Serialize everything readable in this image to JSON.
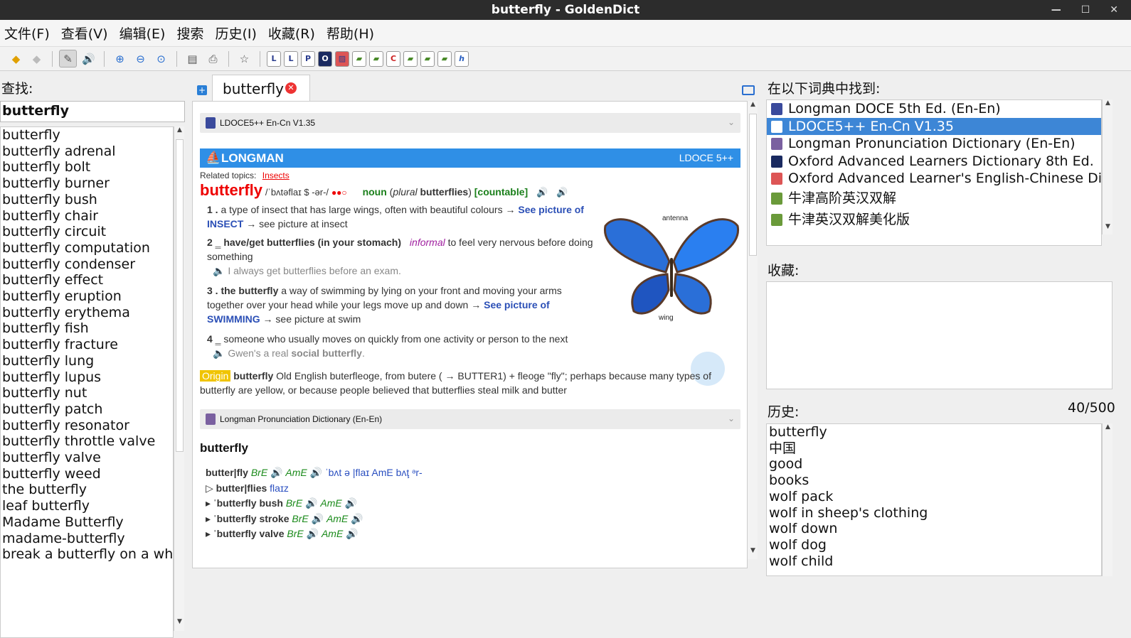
{
  "window": {
    "title": "butterfly - GoldenDict"
  },
  "menu": [
    "文件(F)",
    "查看(V)",
    "编辑(E)",
    "搜索",
    "历史(I)",
    "收藏(R)",
    "帮助(H)"
  ],
  "toolbar_icons": [
    "back-icon",
    "forward-icon",
    "scan-popup-icon",
    "pronounce-icon",
    "zoom-in-icon",
    "zoom-out-icon",
    "zoom-reset-icon",
    "save-icon",
    "print-icon",
    "favorite-icon"
  ],
  "left": {
    "label": "查找:",
    "search_value": "butterfly",
    "words": [
      "butterfly",
      "butterfly adrenal",
      "butterfly bolt",
      "butterfly burner",
      "butterfly bush",
      "butterfly chair",
      "butterfly circuit",
      "butterfly computation",
      "butterfly condenser",
      "butterfly effect",
      "butterfly eruption",
      "butterfly erythema",
      "butterfly fish",
      "butterfly fracture",
      "butterfly lung",
      "butterfly lupus",
      "butterfly nut",
      "butterfly patch",
      "butterfly resonator",
      "butterfly throttle valve",
      "butterfly valve",
      "butterfly weed",
      "the butterfly",
      "leaf butterfly",
      "Madame Butterfly",
      "madame-butterfly",
      "break a butterfly on a wheel"
    ]
  },
  "tab": {
    "label": "butterfly",
    "close": "✕"
  },
  "article": {
    "dict1_title": "LDOCE5++ En-Cn V1.35",
    "brand": "LONGMAN",
    "brand_right": "LDOCE 5++",
    "related_label": "Related topics:",
    "related_link": "Insects",
    "headword": "butterfly",
    "pron": "/ˈbʌtəflaɪ $ -ər-/",
    "freq": "●●○",
    "pos": "noun",
    "plural_label": "plural",
    "plural": "butterflies",
    "countable": "[countable]",
    "s1_num": "1 .",
    "s1_text": "a type of insect that has large wings, often with beautiful colours →",
    "s1_link": "See picture of INSECT",
    "s1_after": "→ see picture at insect",
    "s2_num": "2 ‗",
    "s2_phrase": "have/get butterflies (in your stomach)",
    "s2_reg": "informal",
    "s2_text": "to feel very nervous before doing something",
    "s2_ex": "I always get butterflies before an exam.",
    "s3_num": "3 .",
    "s3_phrase": "the butterfly",
    "s3_text": "a way of swimming by lying on your front and moving your arms together over your head while your legs move up and down →",
    "s3_link": "See picture of SWIMMING",
    "s3_after": "→ see picture at swim",
    "s4_num": "4 ‗",
    "s4_text": "someone who usually moves on quickly from one activity or person to the next",
    "s4_ex_pre": "Gwen's a real",
    "s4_ex_bold": "social butterfly",
    "origin_label": "Origin",
    "origin_word": "butterfly",
    "origin_text": "Old English buterfleoge, from butere ( → BUTTER1) + fleoge \"fly\"; perhaps because many types of butterfly are yellow, or because people believed that butterflies steal milk and butter",
    "img_label_antenna": "antenna",
    "img_label_wing": "wing",
    "dict2_title": "Longman Pronunciation Dictionary (En-En)",
    "lpd_head": "butterfly",
    "lpd_lines": [
      {
        "mark": "",
        "word": "butter|fly",
        "bre": "BrE",
        "ame": "AmE",
        "ipa": "ˈbʌt ə |flaɪ  AmE bʌţ ᵊr-"
      },
      {
        "mark": "▷",
        "word": "butter|flies",
        "bre": "",
        "ame": "",
        "ipa": "flaɪz"
      },
      {
        "mark": "▸",
        "word": "ˈbutterfly bush",
        "bre": "BrE",
        "ame": "AmE",
        "ipa": ""
      },
      {
        "mark": "▸",
        "word": "ˈbutterfly stroke",
        "bre": "BrE",
        "ame": "AmE",
        "ipa": ""
      },
      {
        "mark": "▸",
        "word": "ˈbutterfly valve",
        "bre": "BrE",
        "ame": "AmE",
        "ipa": ""
      }
    ]
  },
  "right": {
    "found_label": "在以下词典中找到:",
    "dicts": [
      "Longman DOCE 5th Ed. (En-En)",
      "LDOCE5++ En-Cn V1.35",
      "Longman Pronunciation Dictionary (En-En)",
      "Oxford Advanced Learners Dictionary 8th Ed.",
      "Oxford Advanced Learner's English-Chinese Dictionary",
      "牛津高阶英汉双解",
      "牛津英汉双解美化版"
    ],
    "fav_label": "收藏:",
    "history_label": "历史:",
    "history_count": "40/500",
    "history": [
      "butterfly",
      "中国",
      "good",
      "books",
      "wolf pack",
      "wolf in sheep's clothing",
      "wolf down",
      "wolf dog",
      "wolf child"
    ]
  },
  "colors": {
    "accent": "#2f8fe6",
    "selection": "#3d86d6",
    "headword": "#e00000"
  }
}
